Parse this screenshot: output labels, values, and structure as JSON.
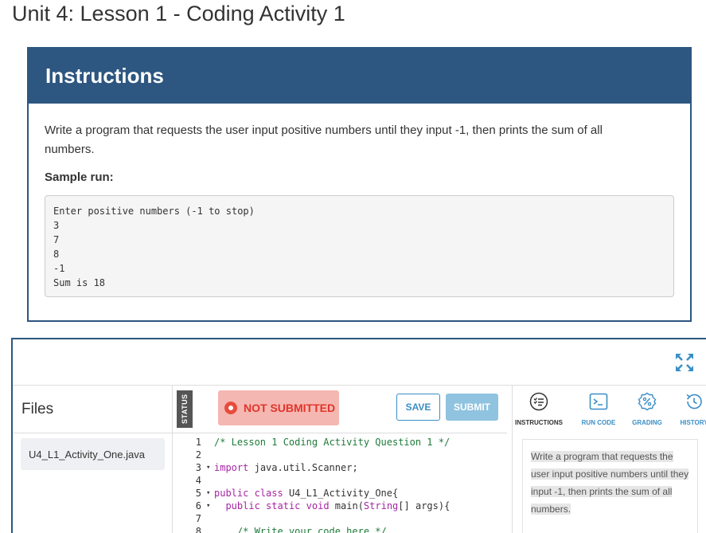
{
  "page": {
    "title": "Unit 4: Lesson 1 - Coding Activity 1"
  },
  "instructions_card": {
    "heading": "Instructions",
    "description": "Write a program that requests the user input positive numbers until they input -1, then prints the sum of all numbers.",
    "sample_label": "Sample run:",
    "sample_lines": [
      "Enter positive numbers (-1 to stop)",
      "3",
      "7",
      "8",
      "-1",
      "Sum is 18"
    ]
  },
  "ide": {
    "files": {
      "title": "Files",
      "items": [
        "U4_L1_Activity_One.java"
      ]
    },
    "status_label": "STATUS",
    "submission_status": "NOT SUBMITTED",
    "save_label": "SAVE",
    "submit_label": "SUBMIT",
    "code_lines": [
      {
        "num": "1",
        "fold": "",
        "text": "/* Lesson 1 Coding Activity Question 1 */",
        "kind": "comment"
      },
      {
        "num": "2",
        "fold": "",
        "text": "",
        "kind": "plain"
      },
      {
        "num": "3",
        "fold": "▾",
        "text": "import java.util.Scanner;",
        "kind": "import"
      },
      {
        "num": "4",
        "fold": "",
        "text": "",
        "kind": "plain"
      },
      {
        "num": "5",
        "fold": "▾",
        "text": "public class U4_L1_Activity_One{",
        "kind": "class"
      },
      {
        "num": "6",
        "fold": "▾",
        "text": "  public static void main(String[] args){",
        "kind": "method"
      },
      {
        "num": "7",
        "fold": "",
        "text": "",
        "kind": "plain"
      },
      {
        "num": "8",
        "fold": "",
        "text": "    /* Write your code here */",
        "kind": "comment"
      }
    ],
    "right_tabs": [
      {
        "label": "INSTRUCTIONS",
        "icon": "list-icon",
        "color": "#333333"
      },
      {
        "label": "RUN CODE",
        "icon": "terminal-icon",
        "color": "#3a8ec6"
      },
      {
        "label": "GRADING",
        "icon": "percent-badge-icon",
        "color": "#3a8ec6"
      },
      {
        "label": "HISTORY",
        "icon": "history-icon",
        "color": "#3a8ec6"
      }
    ],
    "right_text": "Write a program that requests the user input positive numbers until they input -1, then prints the sum of all numbers."
  },
  "colors": {
    "header": "#2d5680",
    "accent": "#3a8ec6",
    "not_submitted_bg": "#f5b7b1",
    "not_submitted_fg": "#e0352b"
  }
}
